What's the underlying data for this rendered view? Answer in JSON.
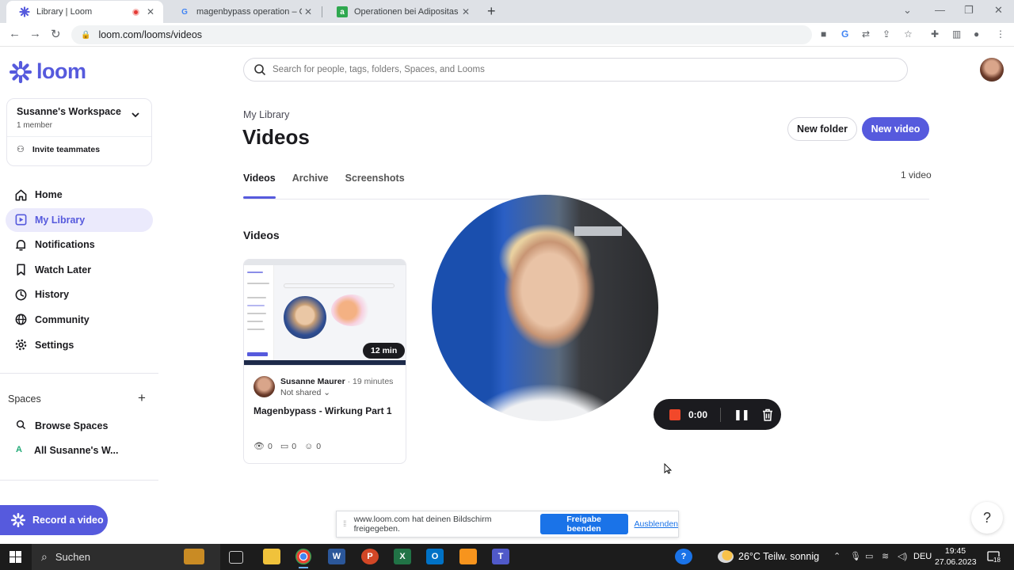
{
  "browser": {
    "tabs": [
      {
        "title": "Library | Loom",
        "active": true
      },
      {
        "title": "magenbypass operation – Googl",
        "active": false
      },
      {
        "title": "Operationen bei Adipositas (kran",
        "active": false
      }
    ],
    "url": "loom.com/looms/videos"
  },
  "sidebar": {
    "logo": "loom",
    "workspace": {
      "name": "Susanne's Workspace",
      "members": "1 member",
      "invite": "Invite teammates"
    },
    "nav": [
      {
        "label": "Home",
        "icon": "home-icon",
        "active": false
      },
      {
        "label": "My Library",
        "icon": "library-icon",
        "active": true
      },
      {
        "label": "Notifications",
        "icon": "bell-icon",
        "active": false
      },
      {
        "label": "Watch Later",
        "icon": "bookmark-icon",
        "active": false
      },
      {
        "label": "History",
        "icon": "clock-icon",
        "active": false
      },
      {
        "label": "Community",
        "icon": "globe-icon",
        "active": false
      },
      {
        "label": "Settings",
        "icon": "gear-icon",
        "active": false
      }
    ],
    "spaces": {
      "header": "Spaces",
      "items": [
        {
          "label": "Browse Spaces",
          "icon": "search-icon"
        },
        {
          "label": "All Susanne's W...",
          "avatar": "A"
        }
      ]
    },
    "record_label": "Record a video"
  },
  "main": {
    "search_placeholder": "Search for people, tags, folders, Spaces, and Looms",
    "breadcrumb": "My Library",
    "title": "Videos",
    "new_folder": "New folder",
    "new_video": "New video",
    "tabs": [
      {
        "label": "Videos",
        "active": true
      },
      {
        "label": "Archive",
        "active": false
      },
      {
        "label": "Screenshots",
        "active": false
      }
    ],
    "count": "1 video",
    "section_title": "Videos",
    "videos": [
      {
        "duration": "12 min",
        "author": "Susanne Maurer",
        "time": "19 minutes",
        "sharing": "Not shared",
        "title": "Magenbypass - Wirkung Part 1",
        "views": "0",
        "comments": "0",
        "reactions": "0"
      }
    ]
  },
  "recorder": {
    "timer": "0:00"
  },
  "share_notice": {
    "message": "www.loom.com hat deinen Bildschirm freigegeben.",
    "stop_label": "Freigabe beenden",
    "hide_label": "Ausblenden"
  },
  "help_label": "?",
  "taskbar": {
    "search_label": "Suchen",
    "weather": "26°C  Teilw. sonnig",
    "language": "DEU",
    "time": "19:45",
    "date": "27.06.2023",
    "notification_count": "18"
  },
  "colors": {
    "brand": "#565add",
    "brand_light": "#ebeafc",
    "record_red": "#f2482a",
    "chrome_blue": "#1a73e8"
  }
}
